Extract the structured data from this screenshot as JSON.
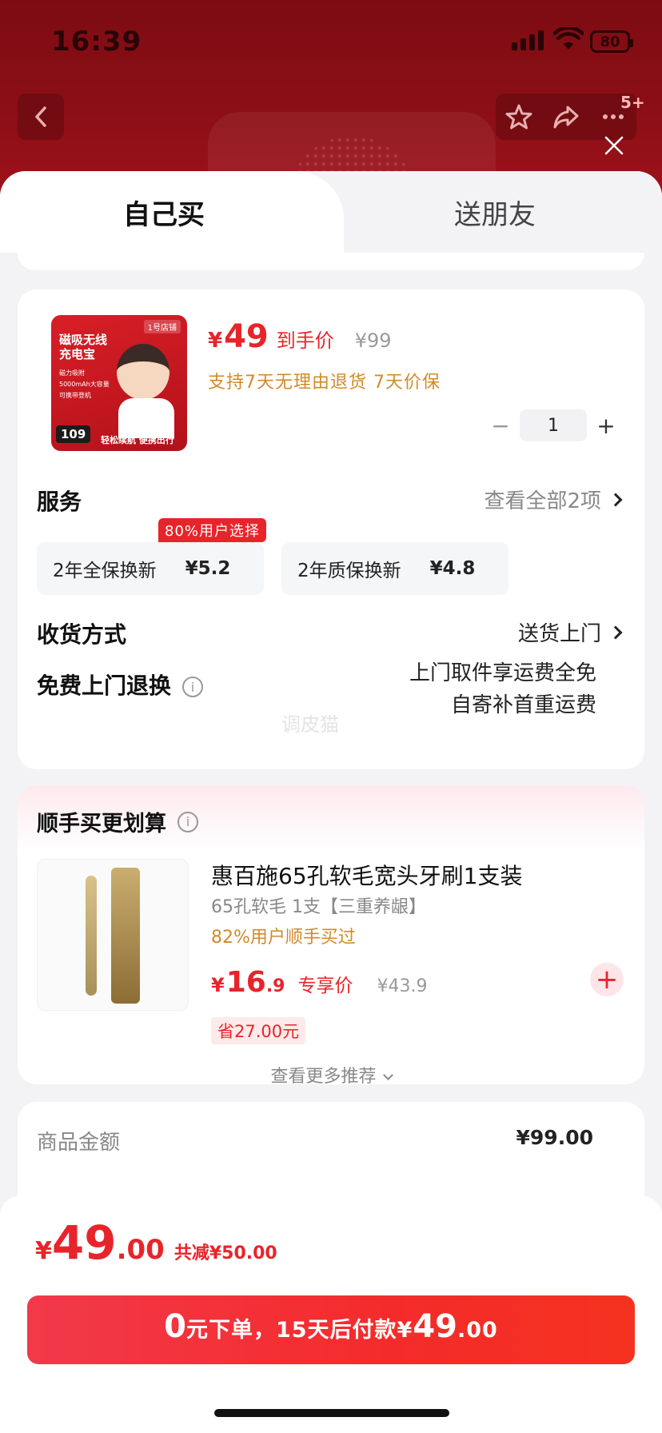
{
  "status_bar": {
    "time": "16:39",
    "battery": "80"
  },
  "nav": {
    "badge": "5+"
  },
  "tabs": [
    {
      "label": "自己买"
    },
    {
      "label": "送朋友"
    }
  ],
  "product": {
    "image": {
      "shop_tag": "1号店铺",
      "title_line1": "磁吸无线",
      "title_line2": "充电宝",
      "features": [
        "磁力吸附",
        "5000mAh大容量",
        "可携带登机"
      ],
      "price_tag": "109",
      "slogan": "轻松续航 便携出行"
    },
    "price_symbol": "¥",
    "price": "49",
    "price_label": "到手价",
    "original_price": "¥99",
    "policy": "支持7天无理由退货  7天价保",
    "quantity": "1",
    "qty_minus": "−",
    "qty_plus": "+"
  },
  "services": {
    "title": "服务",
    "view_all": "查看全部2项",
    "tag": "80%用户选择",
    "options": [
      {
        "name": "2年全保换新",
        "price": "¥5.2"
      },
      {
        "name": "2年质保换新",
        "price": "¥4.8"
      }
    ]
  },
  "delivery": {
    "title": "收货方式",
    "value": "送货上门"
  },
  "returns": {
    "title": "免费上门退换",
    "info_icon": "i",
    "line1": "上门取件享运费全免",
    "line2": "自寄补首重运费",
    "watermark": "调皮猫"
  },
  "recommend": {
    "title": "顺手买更划算",
    "item": {
      "name": "惠百施65孔软毛宽头牙刷1支装",
      "spec": "65孔软毛 1支【三重养龈】",
      "bought": "82%用户顺手买过",
      "price_symbol": "¥",
      "price_int": "16",
      "price_dec": ".9",
      "price_label": "专享价",
      "original_price": "¥43.9",
      "save": "省27.00元",
      "add": "+"
    },
    "more": "查看更多推荐"
  },
  "amount": {
    "label": "商品金额",
    "value": "¥99.00"
  },
  "footer": {
    "total_symbol": "¥",
    "total_int": "49",
    "total_dec": ".00",
    "total_save": "共减¥50.00",
    "pay_big_zero": "0",
    "pay_text1": "元下单，15天后付款¥",
    "pay_big_amount": "49",
    "pay_dec": ".00"
  },
  "colors": {
    "accent": "#e8242b",
    "gold": "#d28a2b"
  }
}
